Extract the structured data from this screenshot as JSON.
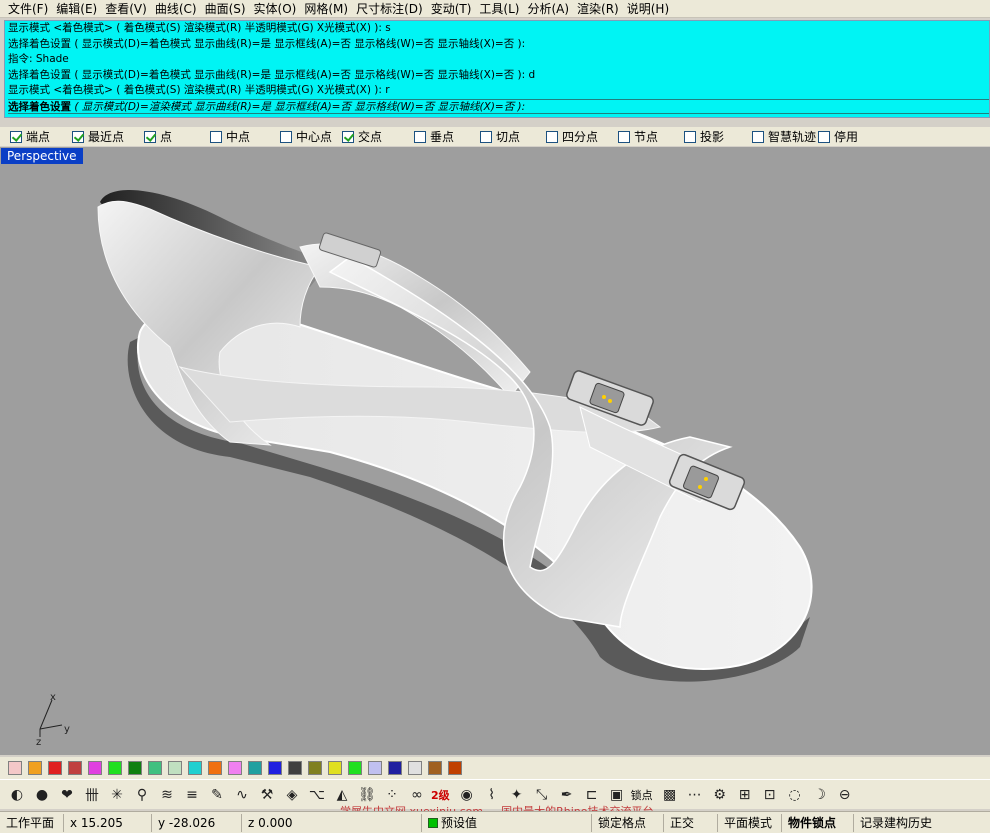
{
  "menubar": {
    "items": [
      "文件(F)",
      "编辑(E)",
      "查看(V)",
      "曲线(C)",
      "曲面(S)",
      "实体(O)",
      "网格(M)",
      "尺寸标注(D)",
      "变动(T)",
      "工具(L)",
      "分析(A)",
      "渲染(R)",
      "说明(H)"
    ]
  },
  "command_history": {
    "lines": [
      "显示模式 <着色模式> ( 着色模式(S)  渲染模式(R)  半透明模式(G)  X光模式(X) ): s",
      "选择着色设置 ( 显示模式(D)=着色模式  显示曲线(R)=是  显示框线(A)=否  显示格线(W)=否  显示轴线(X)=否 ):",
      "指令: Shade",
      "选择着色设置 ( 显示模式(D)=着色模式  显示曲线(R)=是  显示框线(A)=否  显示格线(W)=否  显示轴线(X)=否 ): d",
      "显示模式 <着色模式> ( 着色模式(S)  渲染模式(R)  半透明模式(G)  X光模式(X) ): r"
    ],
    "prompt_label": "选择着色设置",
    "prompt_rest": " ( 显示模式(D)=渲染模式  显示曲线(R)=是  显示框线(A)=否  显示格线(W)=否  显示轴线(X)=否 ):"
  },
  "osnap": {
    "items": [
      {
        "label": "端点",
        "checked": true
      },
      {
        "label": "最近点",
        "checked": true
      },
      {
        "label": "点",
        "checked": true
      },
      {
        "label": "中点",
        "checked": false
      },
      {
        "label": "中心点",
        "checked": false
      },
      {
        "label": "交点",
        "checked": true
      },
      {
        "label": "垂点",
        "checked": false
      },
      {
        "label": "切点",
        "checked": false
      },
      {
        "label": "四分点",
        "checked": false
      },
      {
        "label": "节点",
        "checked": false
      },
      {
        "label": "投影",
        "checked": false
      },
      {
        "label": "智慧轨迹",
        "checked": false
      },
      {
        "label": "停用",
        "checked": false
      }
    ]
  },
  "viewport": {
    "title": "Perspective",
    "background": "#9e9e9e",
    "axis": {
      "x": "x",
      "y": "y",
      "z": "z"
    }
  },
  "palette": {
    "colors": [
      "#f4c8c8",
      "#f0a020",
      "#e02020",
      "#c04040",
      "#e040e0",
      "#20e020",
      "#108010",
      "#40c080",
      "#c0e0c0",
      "#20d0d0",
      "#f07010",
      "#f080f0",
      "#20a0a0",
      "#2020e0",
      "#404040",
      "#808020",
      "#e0e020",
      "#20e020",
      "#c0c0f0",
      "#2020a0",
      "#e0e0e0",
      "#a06020",
      "#c04000"
    ]
  },
  "toolbar": {
    "tools": [
      {
        "icon": "sphere-wire-icon",
        "glyph": "◐"
      },
      {
        "icon": "shaded-sphere-icon",
        "glyph": "●"
      },
      {
        "icon": "heart-icon",
        "glyph": "❤"
      },
      {
        "icon": "stamp-icon",
        "glyph": "卌"
      },
      {
        "icon": "axes-icon",
        "glyph": "✳"
      },
      {
        "icon": "figure-icon",
        "glyph": "⚲"
      },
      {
        "icon": "waves-icon",
        "glyph": "≋"
      },
      {
        "icon": "lines-icon",
        "glyph": "≡"
      },
      {
        "icon": "paint-icon",
        "glyph": "✎"
      },
      {
        "icon": "curve-icon",
        "glyph": "∿"
      },
      {
        "icon": "hammer-icon",
        "glyph": "⚒"
      },
      {
        "icon": "cube-icon",
        "glyph": "◈"
      },
      {
        "icon": "node-icon",
        "glyph": "⌥"
      },
      {
        "icon": "blend-icon",
        "glyph": "◭"
      },
      {
        "icon": "link-icon",
        "glyph": "⛓"
      },
      {
        "icon": "dots-icon",
        "glyph": "⁘"
      },
      {
        "icon": "chain-icon",
        "glyph": "∞"
      }
    ],
    "level_label": "2级",
    "tools_right": [
      {
        "icon": "ball-icon",
        "glyph": "◉"
      },
      {
        "icon": "spring-icon",
        "glyph": "⌇"
      },
      {
        "icon": "text-art-icon",
        "glyph": "✦"
      },
      {
        "icon": "resize-icon",
        "glyph": "⤡"
      },
      {
        "icon": "pen-icon",
        "glyph": "✒"
      },
      {
        "icon": "dimension-icon",
        "glyph": "⊏"
      },
      {
        "icon": "box-icon",
        "glyph": "▣"
      }
    ],
    "lock_label": "锁点",
    "tools_end": [
      {
        "icon": "texture-icon",
        "glyph": "▩"
      },
      {
        "icon": "dash-line-icon",
        "glyph": "⋯"
      },
      {
        "icon": "gear-icon",
        "glyph": "⚙"
      },
      {
        "icon": "windows-icon",
        "glyph": "⊞"
      },
      {
        "icon": "open-icon",
        "glyph": "⊡"
      },
      {
        "icon": "lasso-icon",
        "glyph": "◌"
      },
      {
        "icon": "banana-icon",
        "glyph": "☽"
      },
      {
        "icon": "cylinder-icon",
        "glyph": "⊖"
      }
    ],
    "watermark": "学犀牛中文网 xuexiniu.com — 国内最大的Rhino技术交流平台"
  },
  "statusbar": {
    "workplane": "工作平面",
    "x": "x 15.205",
    "y": "y -28.026",
    "z": "z 0.000",
    "layer": "预设值",
    "grid_snap": "锁定格点",
    "ortho": "正交",
    "planar": "平面模式",
    "osnap": "物件锁点",
    "history": "记录建构历史"
  },
  "colors": {
    "command_bg": "#00f4f4",
    "viewport_title_bg": "#0a3fc6",
    "chrome": "#ece9d8"
  }
}
